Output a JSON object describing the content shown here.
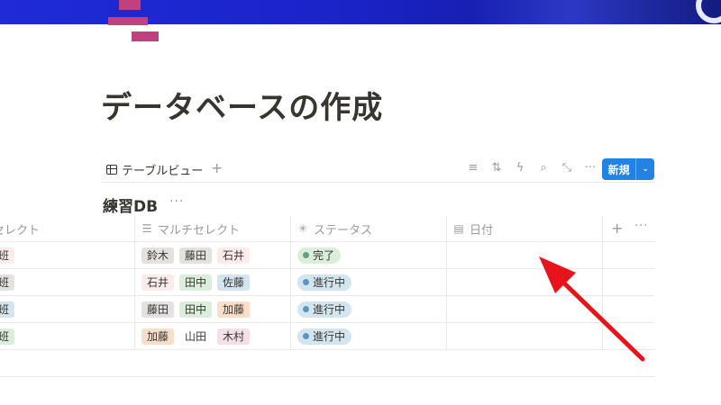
{
  "page": {
    "title": "データベースの作成"
  },
  "view_bar": {
    "tab_label": "テーブルビュー",
    "add_view": "+",
    "tools": [
      {
        "name": "filter-icon",
        "glyph": "≡"
      },
      {
        "name": "sort-icon",
        "glyph": "⇅"
      },
      {
        "name": "automation-icon",
        "glyph": "ϟ"
      },
      {
        "name": "search-icon",
        "glyph": "⌕"
      },
      {
        "name": "expand-icon",
        "glyph": "⤡"
      },
      {
        "name": "more-icon",
        "glyph": "···"
      }
    ],
    "new_button": "新規",
    "new_chevron": "⌄"
  },
  "database": {
    "title": "練習DB",
    "more": "···"
  },
  "table": {
    "headers": {
      "select": "セレクト",
      "multi_select": "マルチセレクト",
      "status": "ステータス",
      "date": "日付",
      "add": "+",
      "more": "···"
    },
    "rows": [
      {
        "select": "班",
        "select_color": "#fdebec",
        "tags": [
          {
            "text": "鈴木",
            "color": "#e3e2e0"
          },
          {
            "text": "藤田",
            "color": "#e3e2e0"
          },
          {
            "text": "石井",
            "color": "#fdebec"
          }
        ],
        "status": "完了",
        "status_bg": "#dbeddb",
        "status_dot": "#6c9b7d"
      },
      {
        "select": "班",
        "select_color": "#e3e2e0",
        "tags": [
          {
            "text": "石井",
            "color": "#fdebec"
          },
          {
            "text": "田中",
            "color": "#dbeddb"
          },
          {
            "text": "佐藤",
            "color": "#d3e5ef"
          }
        ],
        "status": "進行中",
        "status_bg": "#d3e5ef",
        "status_dot": "#5b97bd"
      },
      {
        "select": "班",
        "select_color": "#d3e5ef",
        "tags": [
          {
            "text": "藤田",
            "color": "#e3e2e0"
          },
          {
            "text": "田中",
            "color": "#dbeddb"
          },
          {
            "text": "加藤",
            "color": "#fadec9"
          }
        ],
        "status": "進行中",
        "status_bg": "#d3e5ef",
        "status_dot": "#5b97bd"
      },
      {
        "select": "班",
        "select_color": "#dbeddb",
        "tags": [
          {
            "text": "加藤",
            "color": "#fadec9"
          },
          {
            "text": "山田",
            "color": "#ffffff"
          },
          {
            "text": "木村",
            "color": "#f5e0e9"
          }
        ],
        "status": "進行中",
        "status_bg": "#d3e5ef",
        "status_dot": "#5b97bd"
      }
    ]
  },
  "colors": {
    "accent": "#2383e2",
    "arrow": "#e8141c",
    "cover": "#1f2bd6",
    "logo": "#c2407f"
  }
}
